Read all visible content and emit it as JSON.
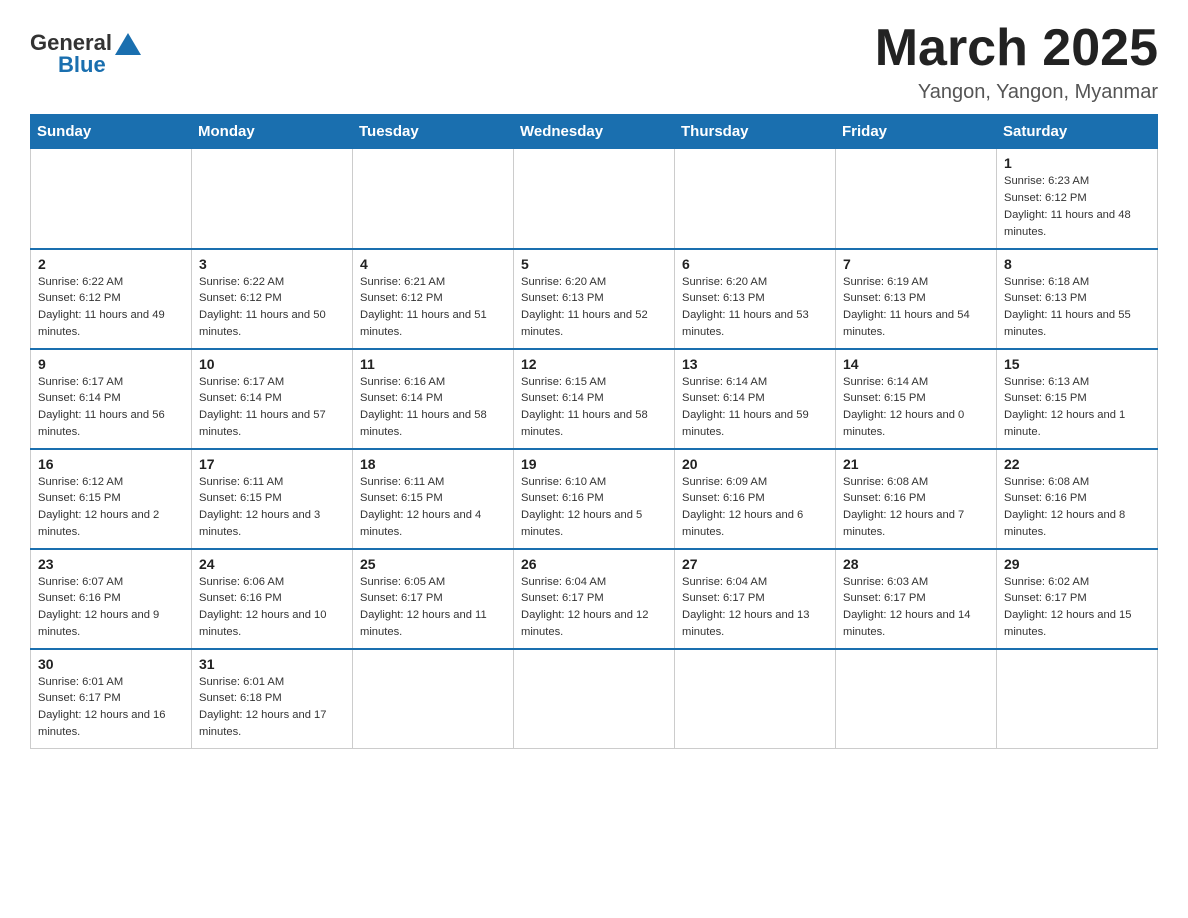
{
  "header": {
    "logo_general": "General",
    "logo_blue": "Blue",
    "title": "March 2025",
    "subtitle": "Yangon, Yangon, Myanmar"
  },
  "days_of_week": [
    "Sunday",
    "Monday",
    "Tuesday",
    "Wednesday",
    "Thursday",
    "Friday",
    "Saturday"
  ],
  "weeks": [
    [
      {
        "day": "",
        "sunrise": "",
        "sunset": "",
        "daylight": ""
      },
      {
        "day": "",
        "sunrise": "",
        "sunset": "",
        "daylight": ""
      },
      {
        "day": "",
        "sunrise": "",
        "sunset": "",
        "daylight": ""
      },
      {
        "day": "",
        "sunrise": "",
        "sunset": "",
        "daylight": ""
      },
      {
        "day": "",
        "sunrise": "",
        "sunset": "",
        "daylight": ""
      },
      {
        "day": "",
        "sunrise": "",
        "sunset": "",
        "daylight": ""
      },
      {
        "day": "1",
        "sunrise": "Sunrise: 6:23 AM",
        "sunset": "Sunset: 6:12 PM",
        "daylight": "Daylight: 11 hours and 48 minutes."
      }
    ],
    [
      {
        "day": "2",
        "sunrise": "Sunrise: 6:22 AM",
        "sunset": "Sunset: 6:12 PM",
        "daylight": "Daylight: 11 hours and 49 minutes."
      },
      {
        "day": "3",
        "sunrise": "Sunrise: 6:22 AM",
        "sunset": "Sunset: 6:12 PM",
        "daylight": "Daylight: 11 hours and 50 minutes."
      },
      {
        "day": "4",
        "sunrise": "Sunrise: 6:21 AM",
        "sunset": "Sunset: 6:12 PM",
        "daylight": "Daylight: 11 hours and 51 minutes."
      },
      {
        "day": "5",
        "sunrise": "Sunrise: 6:20 AM",
        "sunset": "Sunset: 6:13 PM",
        "daylight": "Daylight: 11 hours and 52 minutes."
      },
      {
        "day": "6",
        "sunrise": "Sunrise: 6:20 AM",
        "sunset": "Sunset: 6:13 PM",
        "daylight": "Daylight: 11 hours and 53 minutes."
      },
      {
        "day": "7",
        "sunrise": "Sunrise: 6:19 AM",
        "sunset": "Sunset: 6:13 PM",
        "daylight": "Daylight: 11 hours and 54 minutes."
      },
      {
        "day": "8",
        "sunrise": "Sunrise: 6:18 AM",
        "sunset": "Sunset: 6:13 PM",
        "daylight": "Daylight: 11 hours and 55 minutes."
      }
    ],
    [
      {
        "day": "9",
        "sunrise": "Sunrise: 6:17 AM",
        "sunset": "Sunset: 6:14 PM",
        "daylight": "Daylight: 11 hours and 56 minutes."
      },
      {
        "day": "10",
        "sunrise": "Sunrise: 6:17 AM",
        "sunset": "Sunset: 6:14 PM",
        "daylight": "Daylight: 11 hours and 57 minutes."
      },
      {
        "day": "11",
        "sunrise": "Sunrise: 6:16 AM",
        "sunset": "Sunset: 6:14 PM",
        "daylight": "Daylight: 11 hours and 58 minutes."
      },
      {
        "day": "12",
        "sunrise": "Sunrise: 6:15 AM",
        "sunset": "Sunset: 6:14 PM",
        "daylight": "Daylight: 11 hours and 58 minutes."
      },
      {
        "day": "13",
        "sunrise": "Sunrise: 6:14 AM",
        "sunset": "Sunset: 6:14 PM",
        "daylight": "Daylight: 11 hours and 59 minutes."
      },
      {
        "day": "14",
        "sunrise": "Sunrise: 6:14 AM",
        "sunset": "Sunset: 6:15 PM",
        "daylight": "Daylight: 12 hours and 0 minutes."
      },
      {
        "day": "15",
        "sunrise": "Sunrise: 6:13 AM",
        "sunset": "Sunset: 6:15 PM",
        "daylight": "Daylight: 12 hours and 1 minute."
      }
    ],
    [
      {
        "day": "16",
        "sunrise": "Sunrise: 6:12 AM",
        "sunset": "Sunset: 6:15 PM",
        "daylight": "Daylight: 12 hours and 2 minutes."
      },
      {
        "day": "17",
        "sunrise": "Sunrise: 6:11 AM",
        "sunset": "Sunset: 6:15 PM",
        "daylight": "Daylight: 12 hours and 3 minutes."
      },
      {
        "day": "18",
        "sunrise": "Sunrise: 6:11 AM",
        "sunset": "Sunset: 6:15 PM",
        "daylight": "Daylight: 12 hours and 4 minutes."
      },
      {
        "day": "19",
        "sunrise": "Sunrise: 6:10 AM",
        "sunset": "Sunset: 6:16 PM",
        "daylight": "Daylight: 12 hours and 5 minutes."
      },
      {
        "day": "20",
        "sunrise": "Sunrise: 6:09 AM",
        "sunset": "Sunset: 6:16 PM",
        "daylight": "Daylight: 12 hours and 6 minutes."
      },
      {
        "day": "21",
        "sunrise": "Sunrise: 6:08 AM",
        "sunset": "Sunset: 6:16 PM",
        "daylight": "Daylight: 12 hours and 7 minutes."
      },
      {
        "day": "22",
        "sunrise": "Sunrise: 6:08 AM",
        "sunset": "Sunset: 6:16 PM",
        "daylight": "Daylight: 12 hours and 8 minutes."
      }
    ],
    [
      {
        "day": "23",
        "sunrise": "Sunrise: 6:07 AM",
        "sunset": "Sunset: 6:16 PM",
        "daylight": "Daylight: 12 hours and 9 minutes."
      },
      {
        "day": "24",
        "sunrise": "Sunrise: 6:06 AM",
        "sunset": "Sunset: 6:16 PM",
        "daylight": "Daylight: 12 hours and 10 minutes."
      },
      {
        "day": "25",
        "sunrise": "Sunrise: 6:05 AM",
        "sunset": "Sunset: 6:17 PM",
        "daylight": "Daylight: 12 hours and 11 minutes."
      },
      {
        "day": "26",
        "sunrise": "Sunrise: 6:04 AM",
        "sunset": "Sunset: 6:17 PM",
        "daylight": "Daylight: 12 hours and 12 minutes."
      },
      {
        "day": "27",
        "sunrise": "Sunrise: 6:04 AM",
        "sunset": "Sunset: 6:17 PM",
        "daylight": "Daylight: 12 hours and 13 minutes."
      },
      {
        "day": "28",
        "sunrise": "Sunrise: 6:03 AM",
        "sunset": "Sunset: 6:17 PM",
        "daylight": "Daylight: 12 hours and 14 minutes."
      },
      {
        "day": "29",
        "sunrise": "Sunrise: 6:02 AM",
        "sunset": "Sunset: 6:17 PM",
        "daylight": "Daylight: 12 hours and 15 minutes."
      }
    ],
    [
      {
        "day": "30",
        "sunrise": "Sunrise: 6:01 AM",
        "sunset": "Sunset: 6:17 PM",
        "daylight": "Daylight: 12 hours and 16 minutes."
      },
      {
        "day": "31",
        "sunrise": "Sunrise: 6:01 AM",
        "sunset": "Sunset: 6:18 PM",
        "daylight": "Daylight: 12 hours and 17 minutes."
      },
      {
        "day": "",
        "sunrise": "",
        "sunset": "",
        "daylight": ""
      },
      {
        "day": "",
        "sunrise": "",
        "sunset": "",
        "daylight": ""
      },
      {
        "day": "",
        "sunrise": "",
        "sunset": "",
        "daylight": ""
      },
      {
        "day": "",
        "sunrise": "",
        "sunset": "",
        "daylight": ""
      },
      {
        "day": "",
        "sunrise": "",
        "sunset": "",
        "daylight": ""
      }
    ]
  ]
}
